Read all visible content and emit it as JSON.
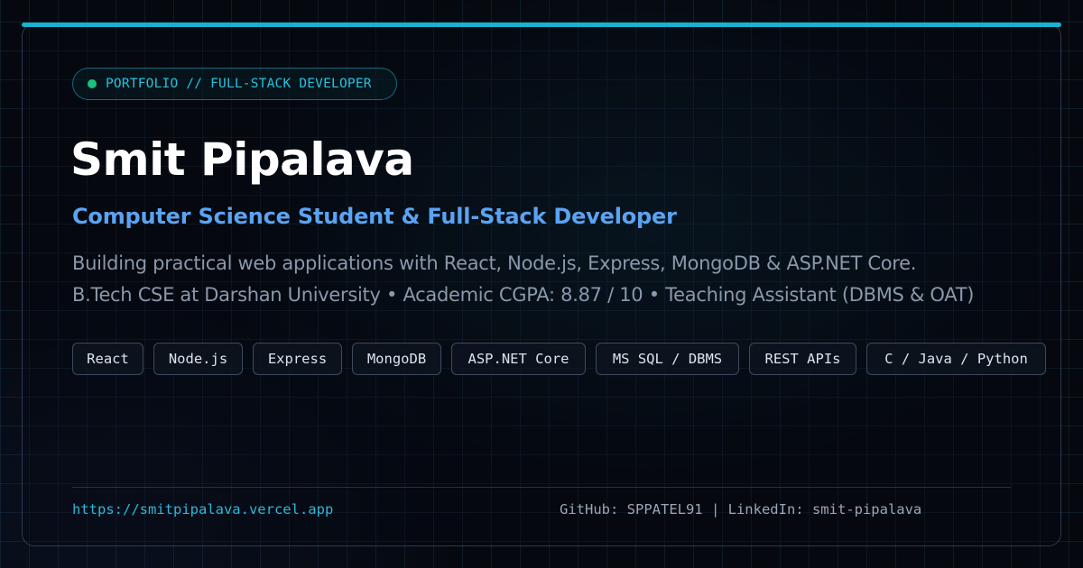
{
  "badge": {
    "text": "PORTFOLIO // FULL-STACK DEVELOPER",
    "dot_color": "#19c27e"
  },
  "hero": {
    "name": "Smit Pipalava",
    "subtitle": "Computer Science Student & Full-Stack Developer",
    "description_line1": "Building practical web applications with React, Node.js, Express, MongoDB & ASP.NET Core.",
    "description_line2": "B.Tech CSE at Darshan University • Academic CGPA: 8.87 / 10 • Teaching Assistant (DBMS & OAT)"
  },
  "tags": [
    "React",
    "Node.js",
    "Express",
    "MongoDB",
    "ASP.NET Core",
    "MS SQL / DBMS",
    "REST APIs",
    "C / Java / Python"
  ],
  "footer": {
    "url": "https://smitpipalava.vercel.app",
    "socials": "GitHub: SPPATEL91 | LinkedIn: smit-pipalava"
  },
  "colors": {
    "accent": "#17b3cf",
    "subtitle": "#5aa3f2",
    "background": "#05080e"
  }
}
